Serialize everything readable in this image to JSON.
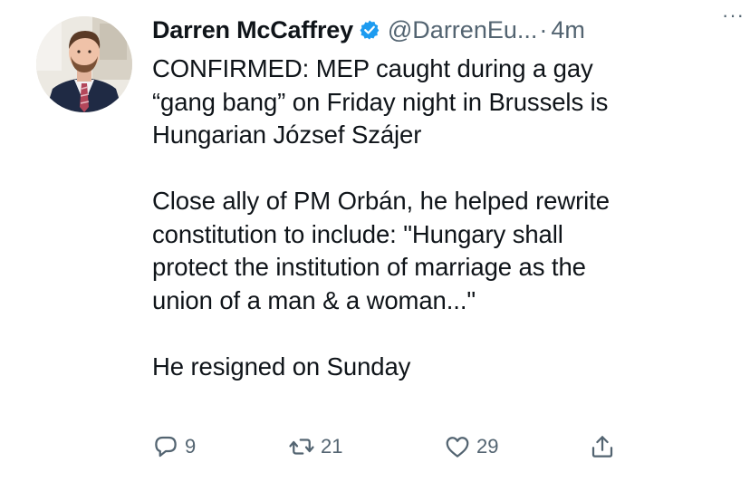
{
  "tweet": {
    "author_name": "Darren McCaffrey",
    "handle": "@DarrenEu...",
    "separator": "·",
    "time": "4m",
    "more_label": "···",
    "lines": [
      "CONFIRMED: MEP caught during a gay",
      "“gang bang” on Friday night in Brussels is",
      "Hungarian József Szájer",
      "",
      "Close ally of PM Orbán, he helped rewrite",
      "constitution to include: \"Hungary shall",
      "protect the institution of marriage as the",
      "union of a man & a woman...\"",
      "",
      "He resigned on Sunday"
    ],
    "actions": {
      "replies": "9",
      "retweets": "21",
      "likes": "29"
    }
  },
  "colors": {
    "text": "#0f1419",
    "secondary": "#536471",
    "verified": "#1d9bf0",
    "background": "#ffffff"
  },
  "icons": [
    "verified-badge-icon",
    "reply-icon",
    "retweet-icon",
    "like-icon",
    "share-icon",
    "more-icon"
  ]
}
